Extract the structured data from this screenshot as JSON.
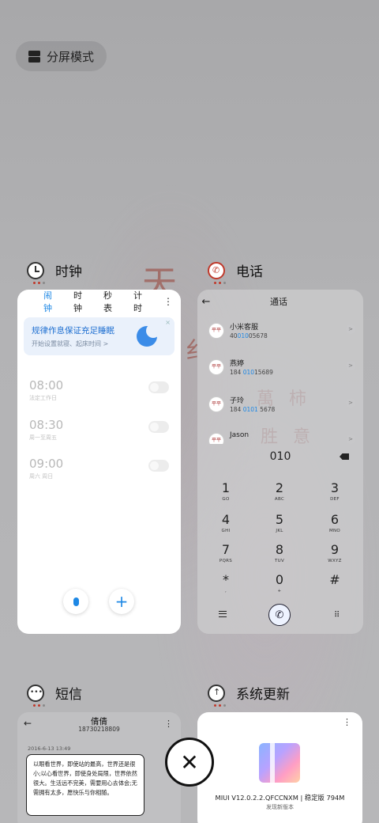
{
  "recents": {
    "split_label": "分屏模式",
    "close_all_icon": "close-icon"
  },
  "wallpaper": {
    "chars_top": "天",
    "chars_mid": "纟",
    "chars_right1": "萬 柿",
    "chars_right2": "胜 意"
  },
  "clock": {
    "app_name": "时钟",
    "tabs": [
      "闹钟",
      "时钟",
      "秒表",
      "计时"
    ],
    "more": "⋮",
    "banner_title": "规律作息保证充足睡眠",
    "banner_sub": "开始设置就寝、起床时间 >",
    "banner_close": "×",
    "alarms": [
      {
        "time": "08:00",
        "repeat": "法定工作日",
        "enabled": false
      },
      {
        "time": "08:30",
        "repeat": "周一至周五",
        "enabled": false
      },
      {
        "time": "09:00",
        "repeat": "周六 周日",
        "enabled": false
      }
    ],
    "add_label": "+"
  },
  "phone": {
    "app_name": "电话",
    "title": "通话",
    "back": "←",
    "contacts": [
      {
        "name": "小米客服",
        "num_pre": "40",
        "num_hl": "010",
        "num_post": "05678",
        "avatar": "平平"
      },
      {
        "name": "燕婷",
        "num_pre": "184 ",
        "num_hl": "010",
        "num_post": "15689",
        "avatar": "平平"
      },
      {
        "name": "子玲",
        "num_pre": "184 ",
        "num_hl": "0101",
        "num_post": " 5678",
        "avatar": "平平"
      },
      {
        "name": "Jason",
        "num_pre": "",
        "num_hl": "",
        "num_post": "",
        "avatar": "平平"
      }
    ],
    "arrow": ">",
    "dialed": "010",
    "keys": [
      {
        "n": "1",
        "l": "GO"
      },
      {
        "n": "2",
        "l": "ABC"
      },
      {
        "n": "3",
        "l": "DEF"
      },
      {
        "n": "4",
        "l": "GHI"
      },
      {
        "n": "5",
        "l": "JKL"
      },
      {
        "n": "6",
        "l": "MNO"
      },
      {
        "n": "7",
        "l": "PQRS"
      },
      {
        "n": "8",
        "l": "TUV"
      },
      {
        "n": "9",
        "l": "WXYZ"
      },
      {
        "n": "*",
        "l": ","
      },
      {
        "n": "0",
        "l": "+"
      },
      {
        "n": "#",
        "l": ""
      }
    ],
    "call_icon": "✆",
    "grid_icon": "⠿"
  },
  "sms": {
    "app_name": "短信",
    "back": "←",
    "more": "⋮",
    "contact_name": "倩倩",
    "contact_number": "18730218809",
    "date": "2016-6-13 13:49",
    "message": "以眼看世界，即使站的最高，世界还是很小;以心看世界，即使身处局限，世界依然很大。生活远不完美，需要用心去体会;无需拥有太多，愿快乐与你相随。"
  },
  "update": {
    "app_name": "系统更新",
    "more": "⋮",
    "version_line": "MIUI V12.0.2.2.QFCCNXM | 稳定版 794M",
    "sub": "发现新版本"
  }
}
